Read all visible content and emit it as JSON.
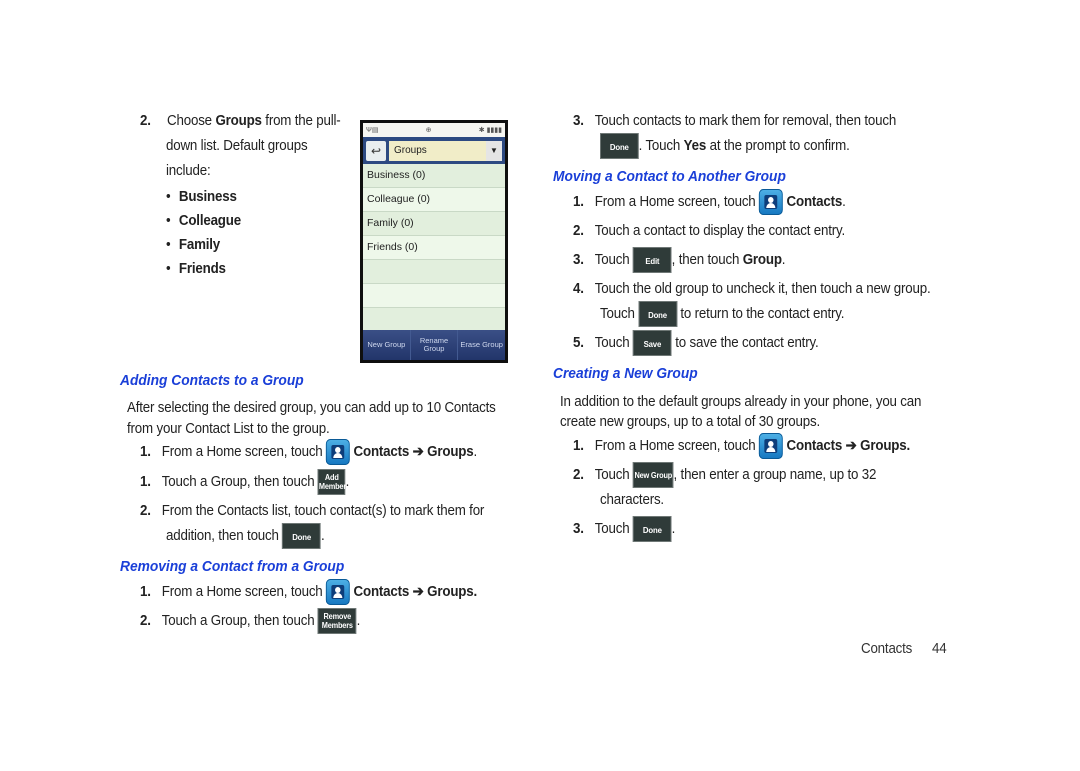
{
  "left": {
    "step_choose": {
      "num": "2.",
      "line1_pre": "Choose ",
      "line1_bold": "Groups",
      "line1_post": " from the pull-",
      "line2": "down list. Default groups",
      "line3": "include:",
      "bullets": [
        "Business",
        "Colleague",
        "Family",
        "Friends"
      ]
    },
    "phone": {
      "status_icons": [
        "signal-icon",
        "network-icon",
        "gps-icon",
        "bluetooth-icon",
        "battery-icon"
      ],
      "back_label": "↩",
      "dropdown_value": "Groups",
      "dropdown_arrow": "▼",
      "groups": [
        "Business (0)",
        "Colleague (0)",
        "Family (0)",
        "Friends (0)",
        "",
        "",
        ""
      ],
      "softkeys": [
        "New Group",
        "Rename Group",
        "Erase Group"
      ]
    },
    "adding": {
      "heading": "Adding Contacts to a Group",
      "intro1": "After selecting the desired group, you can add up to 10 Contacts",
      "intro2": "from your Contact List to the group.",
      "steps": [
        {
          "num": "1.",
          "pre": "From a Home screen, touch",
          "bold": "Contacts  ➔ Groups",
          "post": "."
        },
        {
          "num": "1.",
          "pre": "Touch a Group, then touch",
          "btn_top": "Add",
          "btn_bottom": "Members",
          "post": "."
        },
        {
          "num": "2.",
          "line1": "From the Contacts list, touch contact(s) to mark them for",
          "line2": "addition, then touch",
          "btn": "Done",
          "post": "."
        }
      ]
    },
    "removing": {
      "heading": "Removing a Contact from a Group",
      "steps": [
        {
          "num": "1.",
          "pre": "From a Home screen, touch",
          "bold": "Contacts ➔ Groups."
        },
        {
          "num": "2.",
          "pre": "Touch a Group, then touch",
          "btn_top": "Remove",
          "btn_bottom": "Members",
          "post": "."
        }
      ]
    }
  },
  "right": {
    "removing_cont": {
      "num": "3.",
      "line1": "Touch contacts to mark them for removal, then touch",
      "btn": "Done",
      "line2_pre": ". Touch ",
      "line2_bold": "Yes",
      "line2_post": " at the prompt to confirm."
    },
    "moving": {
      "heading": "Moving a Contact to Another Group",
      "steps": [
        {
          "num": "1.",
          "pre": "From a Home screen, touch",
          "bold": "Contacts",
          "post": "."
        },
        {
          "num": "2.",
          "text": "Touch a contact to display the contact entry."
        },
        {
          "num": "3.",
          "pre": "Touch",
          "btn": "Edit",
          "mid": ", then touch ",
          "bold": "Group",
          "post": "."
        },
        {
          "num": "4.",
          "line1": "Touch the old group to uncheck it, then touch a new group.",
          "pre": "Touch",
          "btn": "Done",
          "post": "to return to the contact entry."
        },
        {
          "num": "5.",
          "pre": "Touch",
          "btn": "Save",
          "post": "to save the contact entry."
        }
      ]
    },
    "creating": {
      "heading": "Creating a New Group",
      "intro1": "In addition to the default groups already in your phone, you can",
      "intro2": "create new groups, up to a total of 30 groups.",
      "steps": [
        {
          "num": "1.",
          "pre": "From a Home screen, touch",
          "bold": "Contacts ➔ Groups."
        },
        {
          "num": "2.",
          "pre": "Touch",
          "btn": "New Group",
          "post": ", then enter a group name, up to 32",
          "line2": "characters."
        },
        {
          "num": "3.",
          "pre": "Touch",
          "btn": "Done",
          "post": "."
        }
      ]
    }
  },
  "footer": {
    "section": "Contacts",
    "page": "44"
  },
  "colors": {
    "heading": "#1a3fd8",
    "button_bg": "#2f3b39",
    "phone_header": "#2d4a82"
  }
}
